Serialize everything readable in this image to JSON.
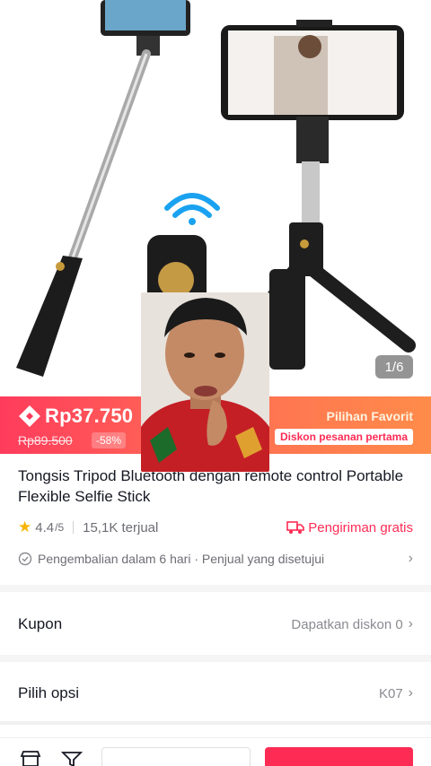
{
  "hero": {
    "page_indicator": "1/6"
  },
  "price": {
    "current": "Rp37.750",
    "original": "Rp89.500",
    "discount": "-58%",
    "favorite_label": "Pilihan Favorit",
    "first_order_badge": "Diskon pesanan pertama"
  },
  "product": {
    "title": "Tongsis Tripod Bluetooth dengan remote control Portable Flexible Selfie Stick",
    "rating": "4.4",
    "rating_max": "/5",
    "sold": "15,1K terjual",
    "shipping": "Pengiriman gratis",
    "policy": "Pengembalian dalam 6 hari · Penjual yang disetujui"
  },
  "coupon": {
    "label": "Kupon",
    "value": "Dapatkan diskon 0"
  },
  "options": {
    "label": "Pilih opsi",
    "value": "K07"
  },
  "colors": {
    "accent": "#fe2c55",
    "banner_start": "#ff3b5c",
    "banner_end": "#ff8c4a",
    "star": "#f5b400"
  },
  "icons": [
    "price-tag-icon",
    "star-icon",
    "truck-icon",
    "check-circle-icon",
    "chevron-right-icon",
    "store-icon",
    "chat-icon"
  ]
}
